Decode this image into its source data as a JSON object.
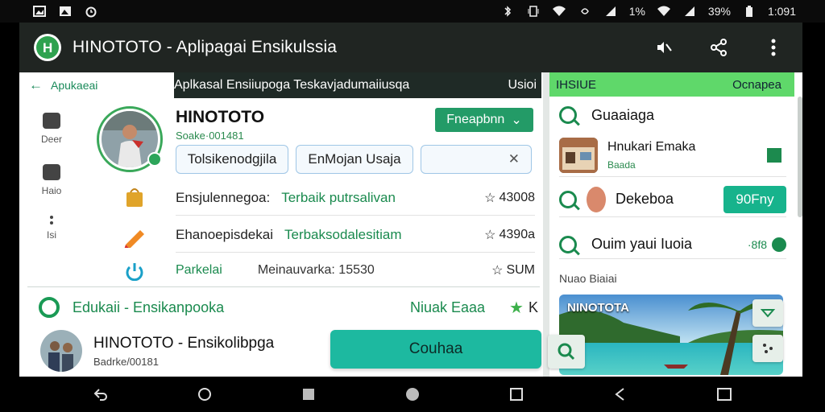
{
  "status_bar": {
    "percent_a": "1%",
    "percent_b": "39%",
    "time": "1:091"
  },
  "app_bar": {
    "title": "HINOTOTO - Aplipagai Ensikulssia",
    "action_1_icon": "mute-icon",
    "action_2_icon": "share-icon",
    "action_3_icon": "more-icon"
  },
  "left": {
    "top_tab": "Apukaeai",
    "header_strip_title": "Aplkasal Ensiiupoga Teskavjadumaiiusqa",
    "header_strip_right": "Usioi",
    "nav_rail": [
      {
        "label": "Deer"
      },
      {
        "label": "Haio"
      },
      {
        "label": "Isi"
      }
    ],
    "profile_name": "HINOTOTO",
    "profile_sub": "Soake·001481",
    "select_label": "Fneapbnn",
    "chips": [
      "Tolsikenodgjila",
      "EnMojan Usaja",
      ""
    ],
    "rows": [
      {
        "label": "Ensjulennegoa:",
        "green": "Terbaik putrsalivan",
        "score": "43008"
      },
      {
        "label": "Ehanoepisdekai",
        "green": "Terbaksodalesitiam",
        "score": "4390a"
      }
    ],
    "row3": {
      "label": "Parkelai",
      "mid": "Meinauvarka: 15530",
      "score": "SUM"
    },
    "edu": {
      "label": "Edukaii - Ensikanpooka",
      "right": "Niuak Eaaa",
      "right_extra": "K"
    },
    "bottom_card": {
      "title": "HINOTOTO - Ensikolibpga",
      "sub": "Badrke/00181"
    },
    "cta_label": "Couhaa"
  },
  "right": {
    "header_left": "IHSIUE",
    "header_right": "Ocnapea",
    "search_label": "Guaaiaga",
    "card": {
      "title": "Hnukari Emaka",
      "sub": "Baada"
    },
    "row3_label": "Dekeboa",
    "row3_button": "90Fny",
    "row4_label": "Ouim yaui Iuoia",
    "row4_value": "·8f8",
    "section_title": "Nuao Biaiai",
    "image_label": "NINOTOTA"
  },
  "colors": {
    "accent_green": "#239b67",
    "teal": "#1db9a0",
    "header_green": "#5fd86a",
    "app_bar_bg": "#202522"
  }
}
